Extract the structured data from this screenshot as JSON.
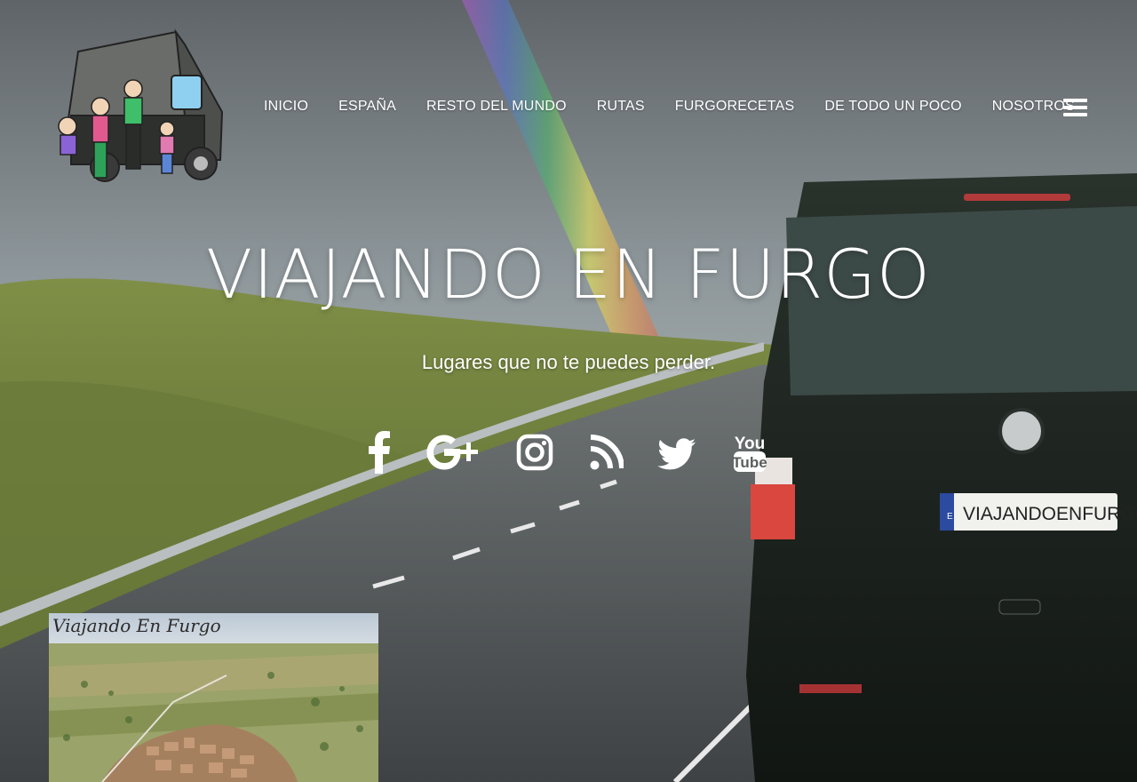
{
  "nav": {
    "items": [
      {
        "label": "INICIO"
      },
      {
        "label": "ESPAÑA"
      },
      {
        "label": "RESTO DEL MUNDO"
      },
      {
        "label": "RUTAS"
      },
      {
        "label": "FURGORECETAS"
      },
      {
        "label": "DE TODO UN POCO"
      },
      {
        "label": "NOSOTROS"
      }
    ],
    "menu_icon": "hamburger-menu-icon"
  },
  "hero": {
    "title": "VIAJANDO EN FURGO",
    "tagline": "Lugares que no te puedes perder.",
    "license_plate": "VIAJANDOENFURGO",
    "plate_country": "E"
  },
  "social": {
    "icons": [
      "facebook-icon",
      "google-plus-icon",
      "instagram-icon",
      "rss-icon",
      "twitter-icon",
      "youtube-icon"
    ]
  },
  "featured": {
    "caption": "Viajando En Furgo"
  },
  "colors": {
    "nav_text": "#ffffff",
    "title_text": "#ffffff",
    "sky": "#8e9aa0",
    "van": "#1c241e"
  }
}
